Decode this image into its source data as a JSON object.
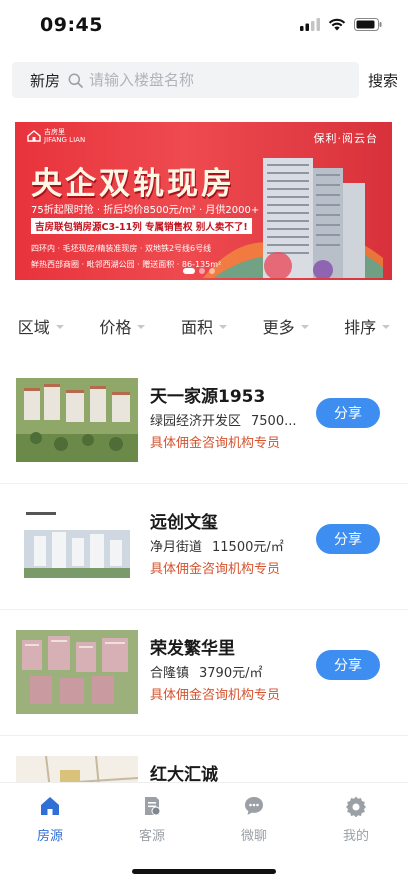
{
  "status_bar": {
    "time": "09:45"
  },
  "search": {
    "city": "新房",
    "placeholder": "请输入楼盘名称",
    "button": "搜索"
  },
  "banner": {
    "logo_text": "吉房里\nJIFANG LIAN",
    "brand": "保利·阅云台",
    "headline": "央企双轨现房",
    "line1": "75折起限时抢 · 折后均价8500元/m² · 月供2000+",
    "line2": "吉房联包销房源C3-11列 专属销售权 别人卖不了!",
    "line3": "四环内 · 毛坯现房/精装准现房 · 双地铁2号线6号线",
    "line4": "鲜热西部商圈 · 毗邻西湖公园 · 赠送面积 · 86-135m²",
    "accent_color": "#e8333c"
  },
  "filters": [
    "区域",
    "价格",
    "面积",
    "更多",
    "排序"
  ],
  "listings": [
    {
      "name": "天一家源1953",
      "district": "绿园经济开发区",
      "price": "7500...",
      "agent": "具体佣金咨询机构专员",
      "share": "分享"
    },
    {
      "name": "远创文玺",
      "district": "净月街道",
      "price": "11500元/㎡",
      "agent": "具体佣金咨询机构专员",
      "share": "分享"
    },
    {
      "name": "荣发繁华里",
      "district": "合隆镇",
      "price": "3790元/㎡",
      "agent": "具体佣金咨询机构专员",
      "share": "分享"
    },
    {
      "name": "红大汇诚",
      "district": "",
      "price": "",
      "agent": "",
      "share": ""
    }
  ],
  "tabs": [
    {
      "label": "房源",
      "icon": "home-icon",
      "active": true
    },
    {
      "label": "客源",
      "icon": "document-icon",
      "active": false
    },
    {
      "label": "微聊",
      "icon": "chat-icon",
      "active": false
    },
    {
      "label": "我的",
      "icon": "gear-icon",
      "active": false
    }
  ],
  "colors": {
    "primary": "#3d8ef0",
    "tab_active": "#2f6fd6",
    "agent_text": "#d4532f"
  }
}
